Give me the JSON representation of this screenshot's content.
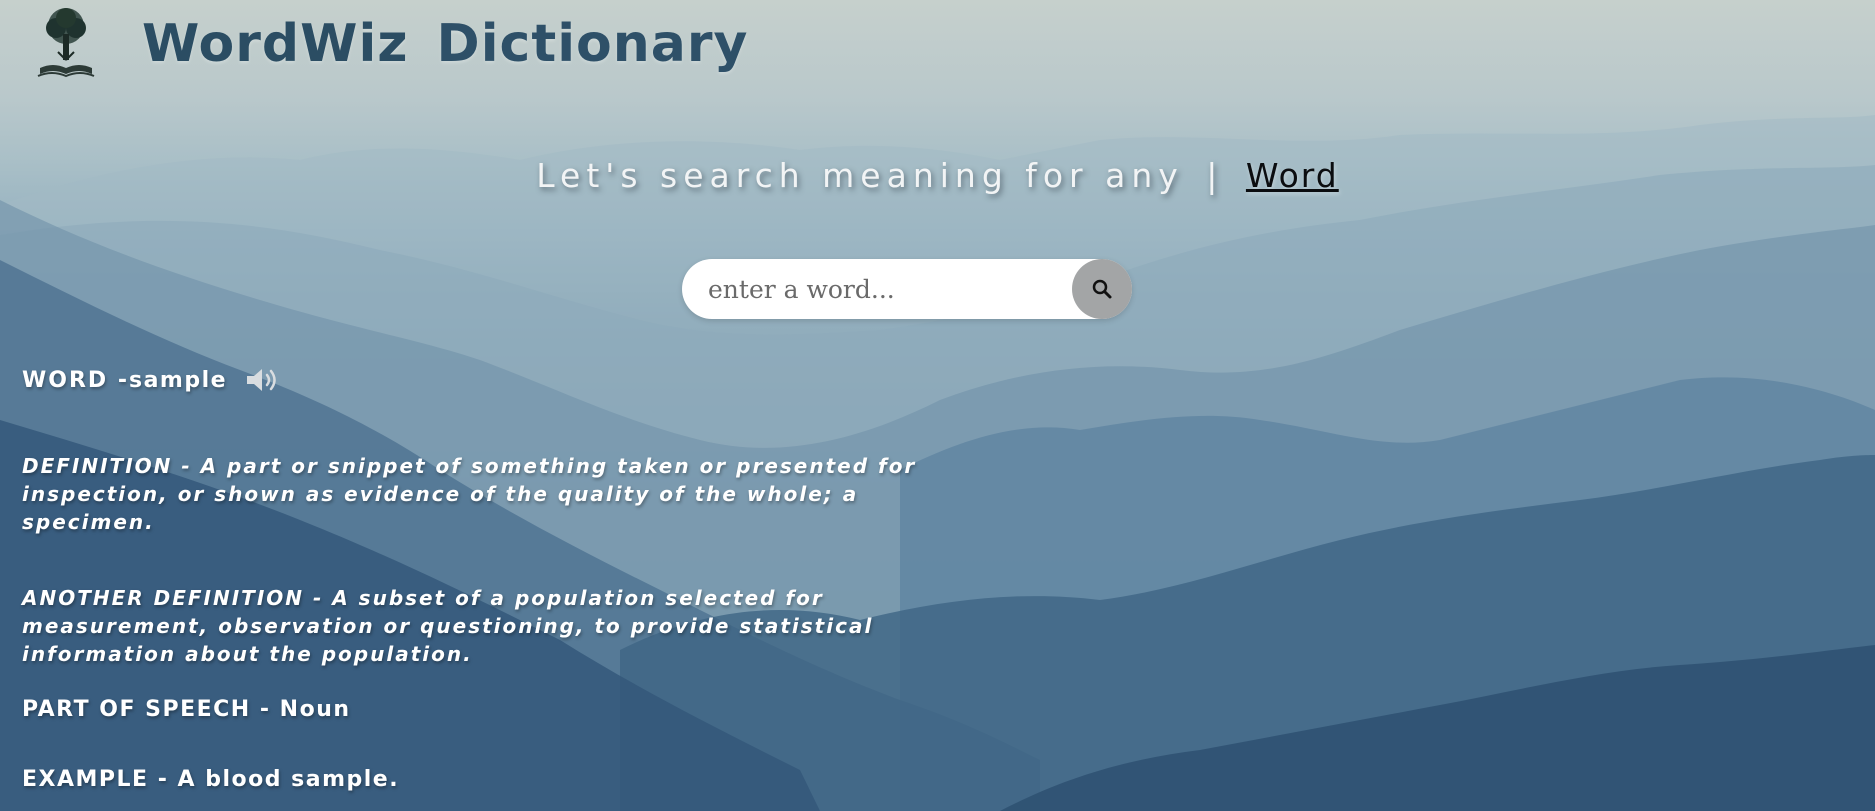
{
  "header": {
    "brand_part1": "WordWiz",
    "brand_part2": "Dictionary",
    "logo_icon": "tree-book-icon"
  },
  "hero": {
    "tagline": "Let's search meaning for any",
    "separator": "|",
    "highlight": "Word"
  },
  "search": {
    "placeholder": "enter a word...",
    "value": "",
    "button_icon": "search-icon"
  },
  "result": {
    "word_label": "WORD - ",
    "word_value": "sample",
    "speaker_icon": "speaker-icon",
    "definition_label": "DEFINITION - ",
    "definition_text": "A part or snippet of something taken or presented for inspection, or shown as evidence of the quality of the whole; a specimen.",
    "another_definition_label": "ANOTHER DEFINITION - ",
    "another_definition_text": "A subset of a population selected for measurement, observation or questioning, to provide statistical information about the population.",
    "part_of_speech_label": "PART OF SPEECH - ",
    "part_of_speech_value": "Noun",
    "example_label": "EXAMPLE - ",
    "example_value": "A blood sample."
  },
  "colors": {
    "brand": "#1f3c52",
    "search_button": "#a3a5a6",
    "text": "#ffffff"
  }
}
